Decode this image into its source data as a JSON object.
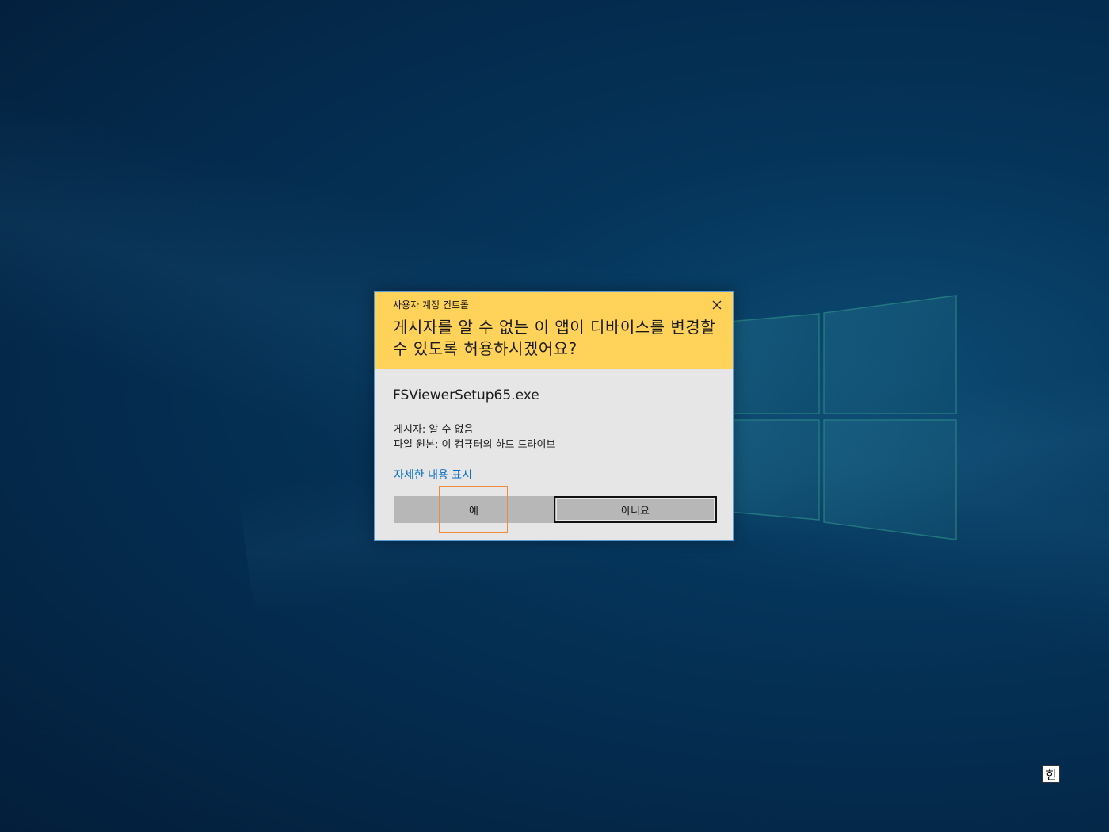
{
  "dialog": {
    "caption": "사용자 계정 컨트롤",
    "question": "게시자를 알 수 없는 이 앱이 디바이스를 변경할 수 있도록 허용하시겠어요?",
    "app_name": "FSViewerSetup65.exe",
    "publisher_line": "게시자: 알 수 없음",
    "origin_line": "파일 원본: 이 컴퓨터의 하드 드라이브",
    "details_link": "자세한 내용 표시",
    "yes_label": "예",
    "no_label": "아니요",
    "header_color": "#ffd25a",
    "body_color": "#e6e6e6",
    "link_color": "#0a6fc2"
  },
  "taskbar": {
    "ime_label": "한"
  },
  "highlight_color": "#f08a3c"
}
